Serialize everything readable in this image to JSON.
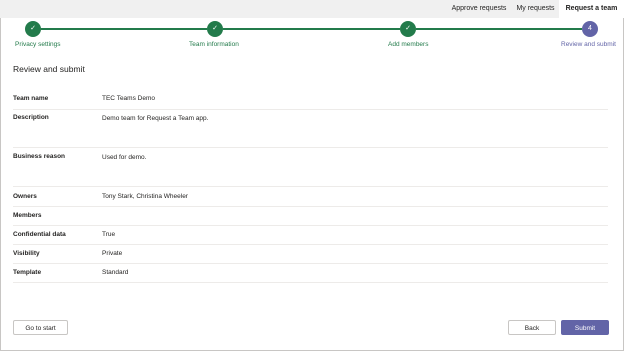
{
  "nav": {
    "tabs": [
      {
        "label": "Approve requests"
      },
      {
        "label": "My requests"
      },
      {
        "label": "Request a team"
      }
    ]
  },
  "stepper": {
    "steps": [
      {
        "label": "Privacy settings",
        "marker": "✓",
        "state": "done"
      },
      {
        "label": "Team information",
        "marker": "✓",
        "state": "done"
      },
      {
        "label": "Add members",
        "marker": "✓",
        "state": "done"
      },
      {
        "label": "Review and submit",
        "marker": "4",
        "state": "current"
      }
    ]
  },
  "page": {
    "title": "Review and submit"
  },
  "review": {
    "rows": [
      {
        "label": "Team name",
        "value": "TEC Teams Demo"
      },
      {
        "label": "Description",
        "value": "Demo team for Request a Team app."
      },
      {
        "label": "Business reason",
        "value": "Used for demo."
      },
      {
        "label": "Owners",
        "value": "Tony Stark,  Christina Wheeler"
      },
      {
        "label": "Members",
        "value": ""
      },
      {
        "label": "Confidential data",
        "value": "True"
      },
      {
        "label": "Visibility",
        "value": "Private"
      },
      {
        "label": "Template",
        "value": "Standard"
      }
    ]
  },
  "footer": {
    "go_to_start": "Go to start",
    "back": "Back",
    "submit": "Submit"
  },
  "colors": {
    "accent": "#6264a7",
    "success": "#237b4b"
  }
}
